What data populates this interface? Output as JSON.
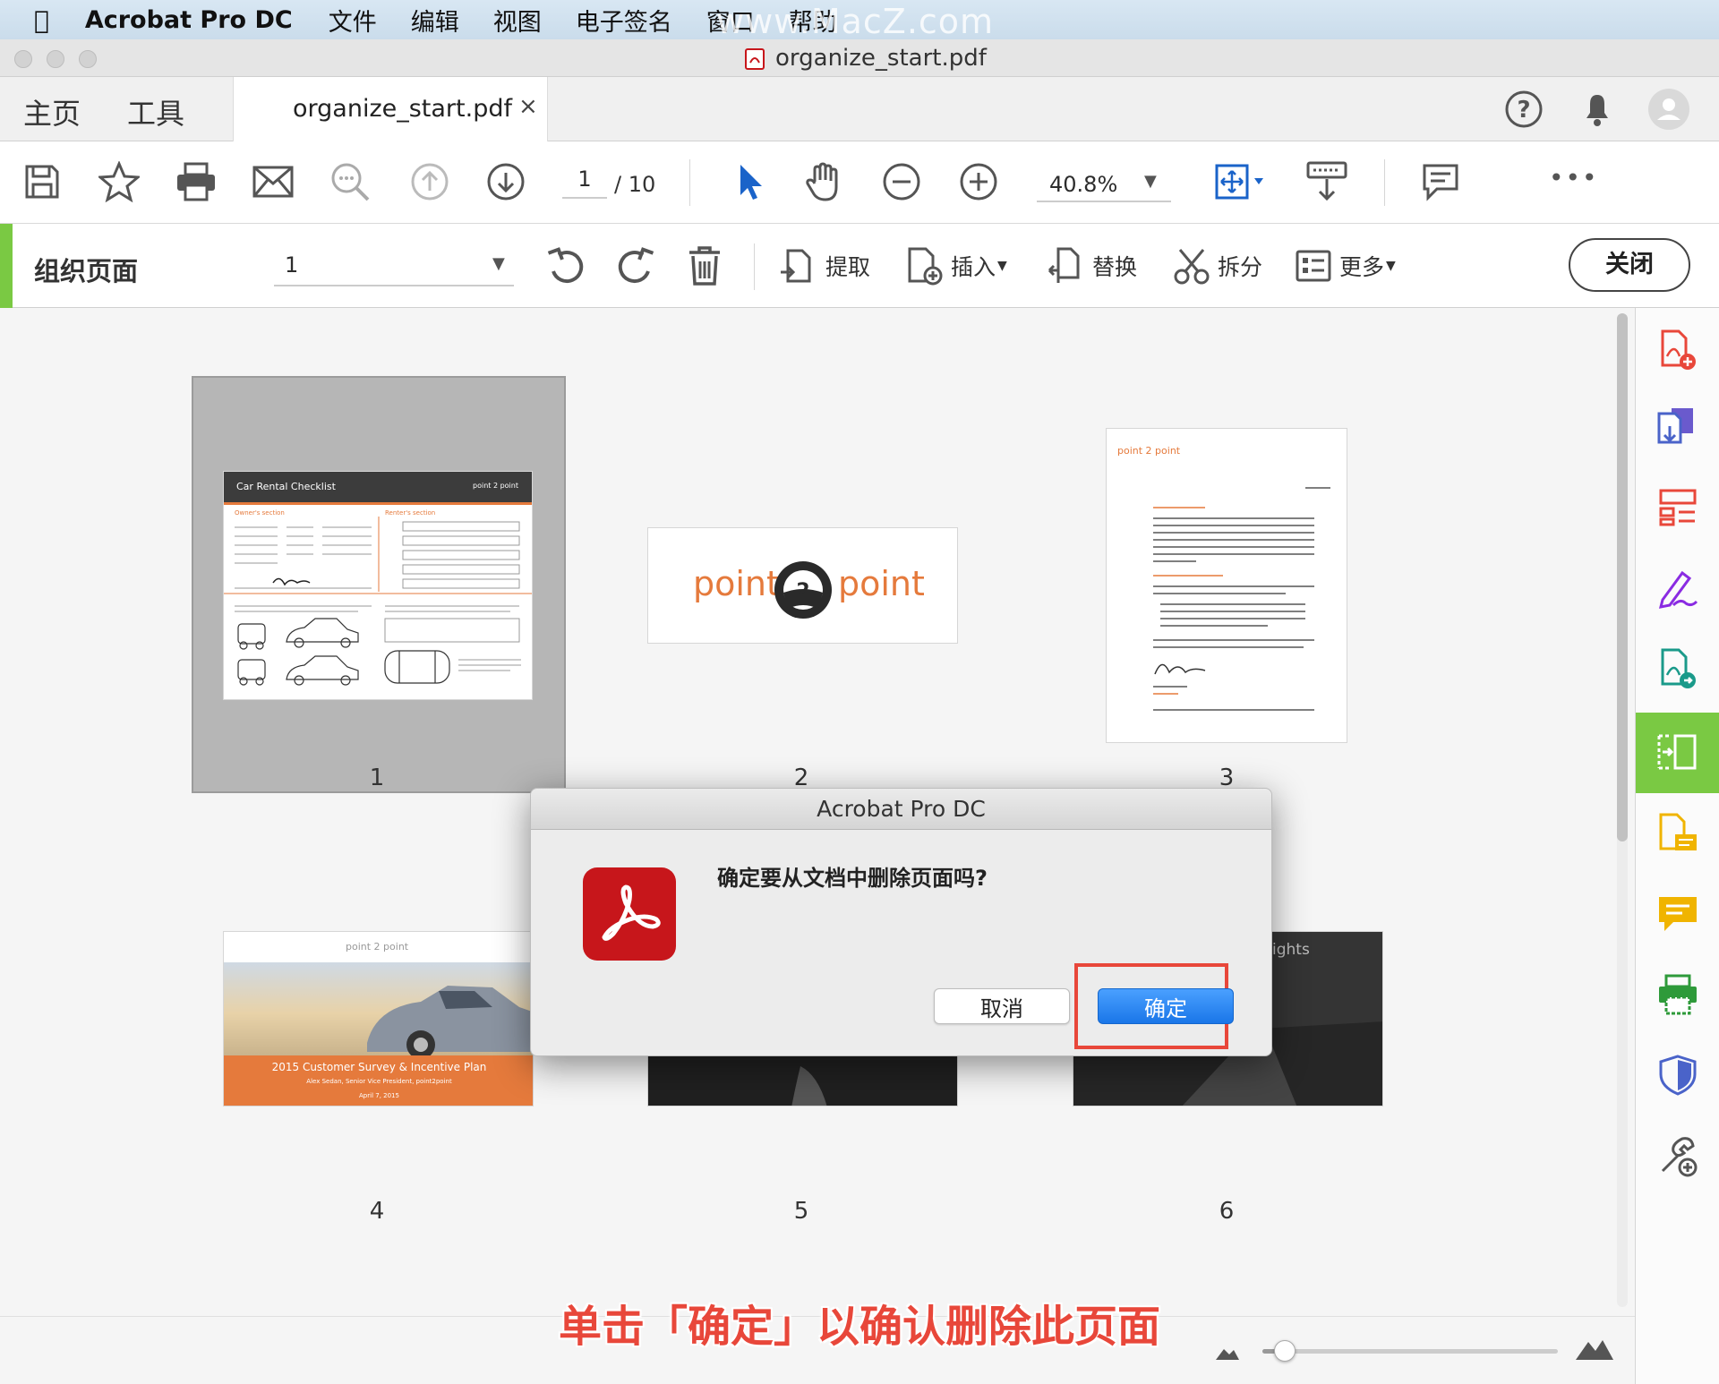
{
  "menubar": {
    "app": "Acrobat Pro DC",
    "items": [
      "文件",
      "编辑",
      "视图",
      "电子签名",
      "窗口",
      "帮助"
    ],
    "watermark": "www.MacZ.com"
  },
  "window": {
    "title": "organize_start.pdf"
  },
  "tabs": {
    "home": "主页",
    "tools": "工具",
    "doc": "organize_start.pdf",
    "close": "×"
  },
  "toolbar": {
    "page_current": "1",
    "page_total": "/ 10",
    "zoom": "40.8%",
    "more": "•••"
  },
  "organize": {
    "title": "组织页面",
    "page_select": "1",
    "extract": "提取",
    "insert": "插入",
    "replace": "替换",
    "split": "拆分",
    "more": "更多",
    "close": "关闭"
  },
  "pages": {
    "p1": {
      "number": "1",
      "header": "Car Rental Checklist",
      "brand": "point 2 point",
      "owner": "Owner's section",
      "renter": "Renter's section"
    },
    "p2": {
      "number": "2",
      "brand_left": "point",
      "brand_right": "point",
      "brand_mid": "2"
    },
    "p3": {
      "number": "3",
      "brand": "point 2 point"
    },
    "p4": {
      "number": "4",
      "brand": "point 2 point",
      "title": "2015 Customer Survey & Incentive Plan",
      "author": "Alex Sedan, Senior Vice President, point2point",
      "date": "April 7, 2015"
    },
    "p5": {
      "number": "5"
    },
    "p6": {
      "number": "6",
      "text": "ights"
    }
  },
  "dialog": {
    "title": "Acrobat Pro DC",
    "message": "确定要从文档中删除页面吗?",
    "cancel": "取消",
    "ok": "确定"
  },
  "caption": "单击「确定」以确认删除此页面",
  "colors": {
    "accent": "#1a76e8",
    "brand": "#e57a3c",
    "highlight": "#e8473a",
    "panel_active": "#7ac943",
    "adobe_red": "#c7161b"
  },
  "zoom_slider": {
    "value": 0.05
  }
}
